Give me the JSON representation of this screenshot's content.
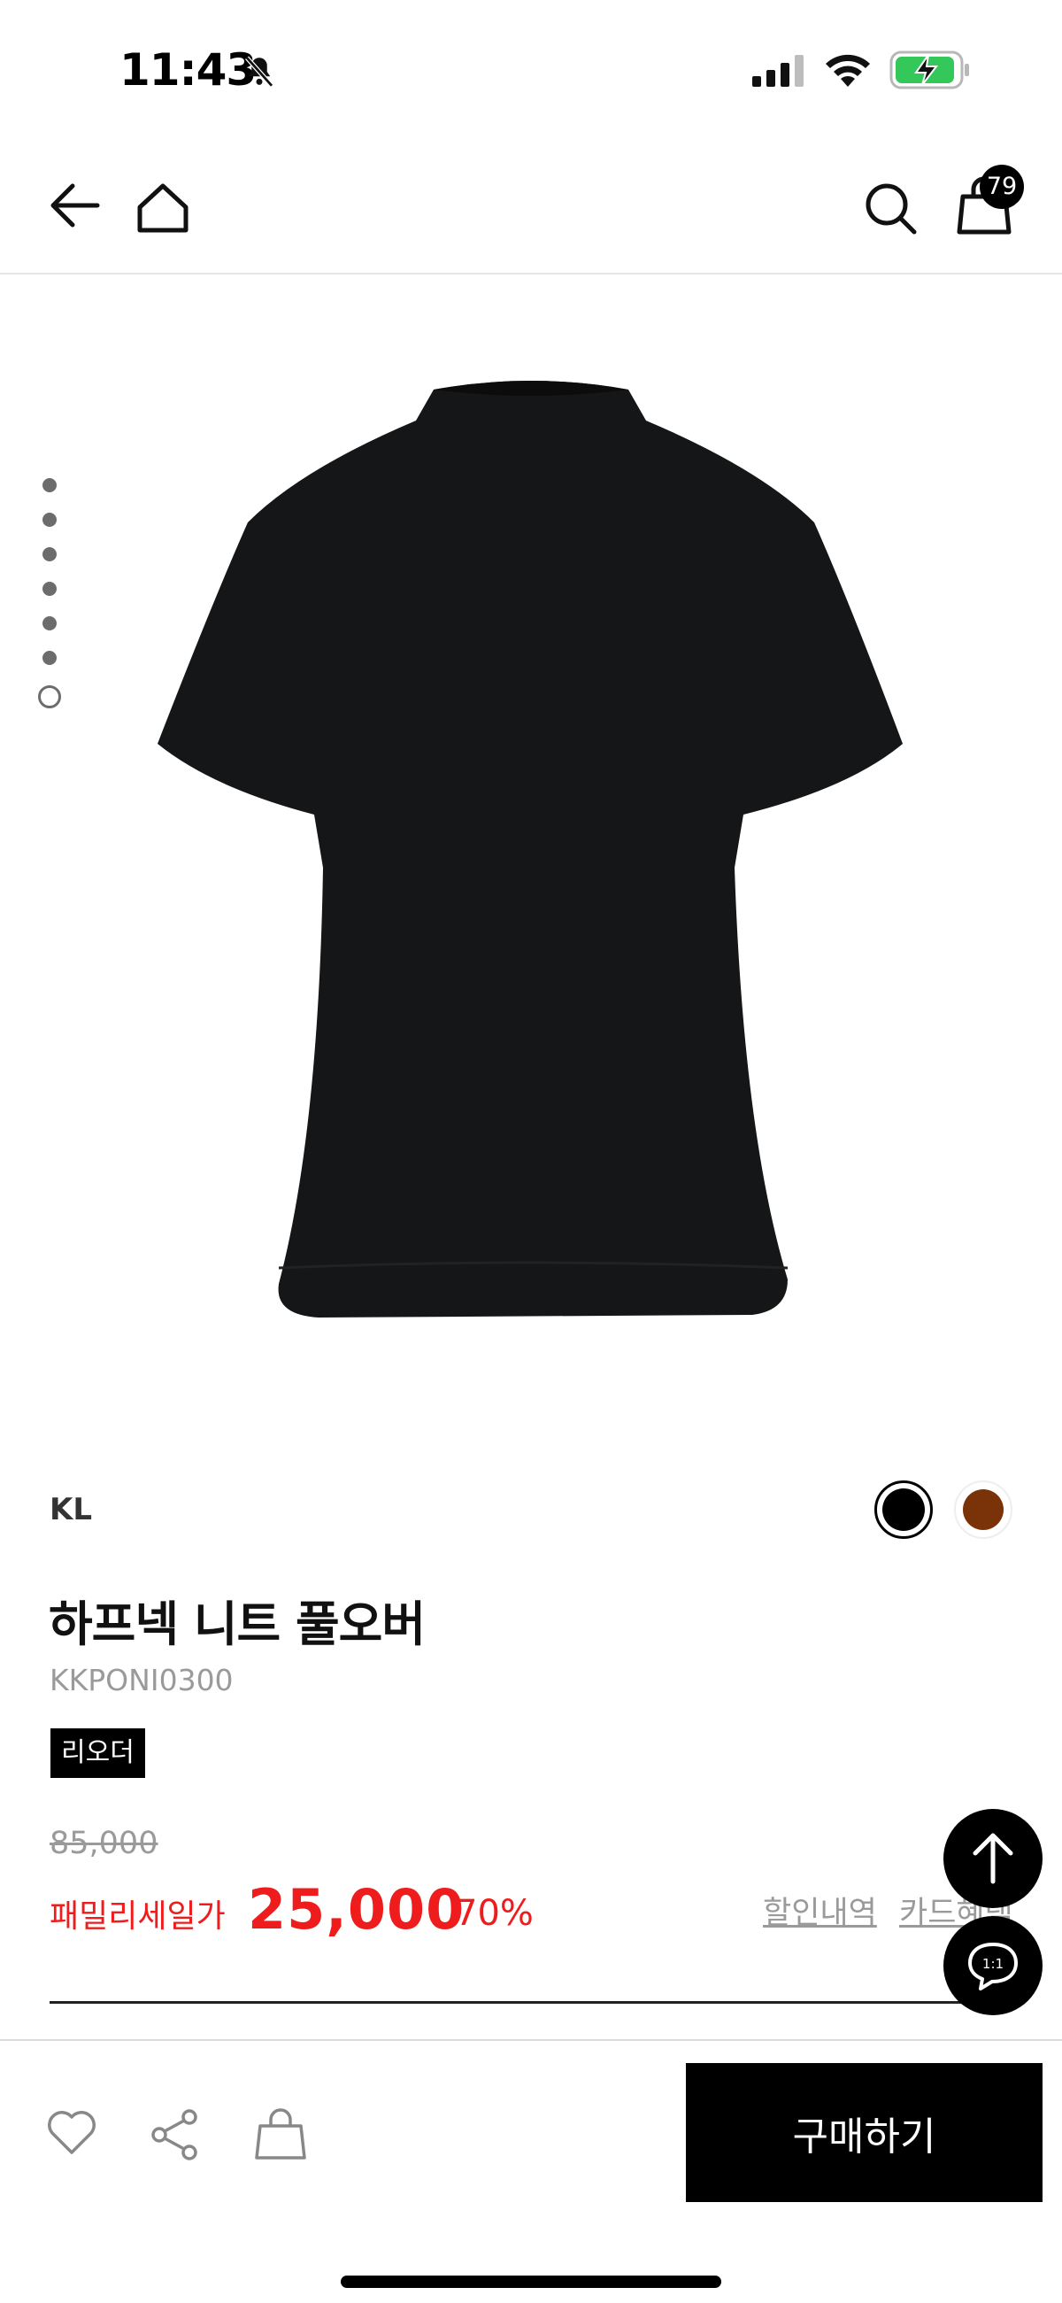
{
  "status_bar": {
    "time": "11:43",
    "icons": [
      "bell-slash-icon",
      "signal-icon",
      "wifi-icon",
      "battery-charging-icon"
    ],
    "battery_color": "#34c759"
  },
  "nav": {
    "icons": [
      "back-arrow-icon",
      "home-icon",
      "search-icon",
      "shopping-bag-icon"
    ],
    "cart_count": "79"
  },
  "gallery": {
    "page_count": 7,
    "active_index": 6
  },
  "product": {
    "brand": "KL",
    "name": "하프넥 니트 풀오버",
    "code": "KKPONI0300",
    "tag": "리오더",
    "color_options": [
      {
        "name": "black",
        "color": "#000000",
        "selected": true
      },
      {
        "name": "brown",
        "color": "#7a3309",
        "selected": false
      }
    ]
  },
  "price": {
    "original": "85,000",
    "label": "패밀리세일가",
    "sale": "25,000",
    "discount": "70%",
    "discount_link": "할인내역",
    "card_link": "카드혜택",
    "accent_color": "#ee1c1c"
  },
  "bottom_bar": {
    "icons": [
      "heart-icon",
      "share-icon",
      "shopping-bag-icon"
    ],
    "buy_label": "구매하기"
  },
  "floating": {
    "chat_label": "1:1"
  }
}
